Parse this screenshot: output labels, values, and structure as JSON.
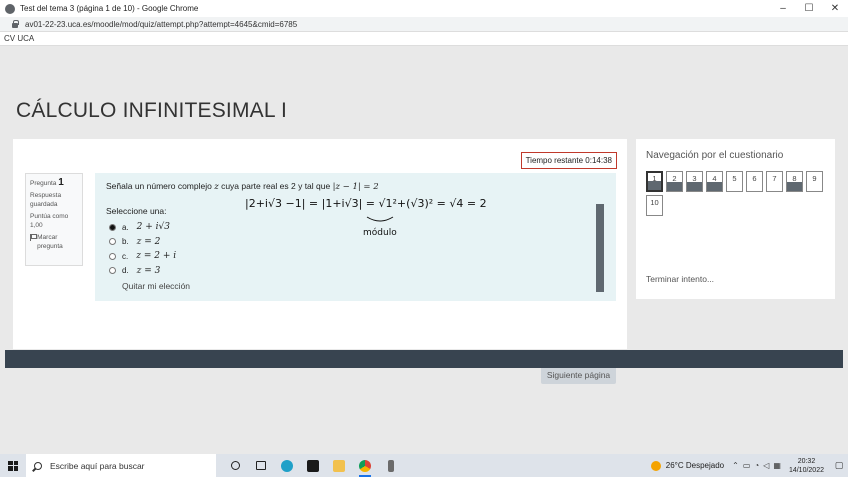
{
  "window": {
    "title": "Test del tema 3 (página 1 de 10) - Google Chrome",
    "minimize": "–",
    "maximize": "☐",
    "close": "✕"
  },
  "browser": {
    "url": "av01-22-23.uca.es/moodle/mod/quiz/attempt.php?attempt=4645&cmid=6785"
  },
  "site": {
    "name": "CV UCA"
  },
  "course": {
    "title": "CÁLCULO INFINITESIMAL I"
  },
  "quiz": {
    "timer": "Tiempo restante 0:14:38",
    "info": {
      "pregunta_label": "Pregunta",
      "pregunta_num": "1",
      "estado": "Respuesta guardada",
      "puntua": "Puntúa como 1,00",
      "marcar": "Marcar pregunta"
    },
    "question": {
      "text_prefix": "Señala un número complejo ",
      "var": "z",
      "text_mid": " cuya parte real es 2 y tal que ",
      "condition": "|z − 1| = 2",
      "prompt": "Seleccione una:",
      "options": [
        {
          "letter": "a.",
          "math": "2 + i√3",
          "selected": true
        },
        {
          "letter": "b.",
          "math": "z = 2",
          "selected": false
        },
        {
          "letter": "c.",
          "math": "z = 2 + i",
          "selected": false
        },
        {
          "letter": "d.",
          "math": "z = 3",
          "selected": false
        }
      ],
      "clear": "Quitar mi elección"
    },
    "handwriting": {
      "line1": "|2+i√3 −1| = |1+i√3| = √1²+(√3)² = √4 = 2",
      "line2": "módulo"
    },
    "next_button": "Siguiente página"
  },
  "navigation": {
    "title": "Navegación por el cuestionario",
    "buttons": [
      {
        "label": "1",
        "state": "current-answered"
      },
      {
        "label": "2",
        "state": "answered"
      },
      {
        "label": "3",
        "state": "answered"
      },
      {
        "label": "4",
        "state": "answered"
      },
      {
        "label": "5",
        "state": "unanswered"
      },
      {
        "label": "6",
        "state": "unanswered"
      },
      {
        "label": "7",
        "state": "unanswered"
      },
      {
        "label": "8",
        "state": "answered"
      },
      {
        "label": "9",
        "state": "unanswered"
      },
      {
        "label": "10",
        "state": "unanswered"
      }
    ],
    "finish": "Terminar intento..."
  },
  "taskbar": {
    "search_placeholder": "Escribe aquí para buscar",
    "weather": "26°C  Despejado",
    "time": "20:32",
    "date": "14/10/2022"
  },
  "colors": {
    "timer_border": "#c0392b",
    "question_bg": "#e7f3f5",
    "answered_fill": "#5f6870",
    "footer": "#384450"
  }
}
